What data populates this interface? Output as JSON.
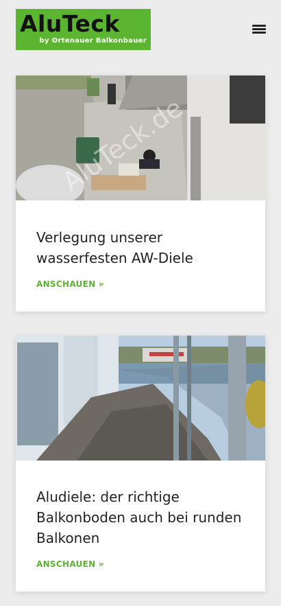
{
  "header": {
    "logo_main": "AluTeck",
    "logo_sub": "by Ortenauer Balkonbauer",
    "menu_icon": "hamburger-menu-icon"
  },
  "posts": [
    {
      "title": "Verlegung unserer wasserfesten AW-Diele",
      "read_more": "ANSCHAUEN »",
      "image_watermark": "AluTeck.de"
    },
    {
      "title": "Aludiele: der richtige Balkonboden auch bei runden Balkonen",
      "read_more": "ANSCHAUEN »"
    }
  ],
  "colors": {
    "brand_green": "#5cb531",
    "background": "#ececec"
  }
}
